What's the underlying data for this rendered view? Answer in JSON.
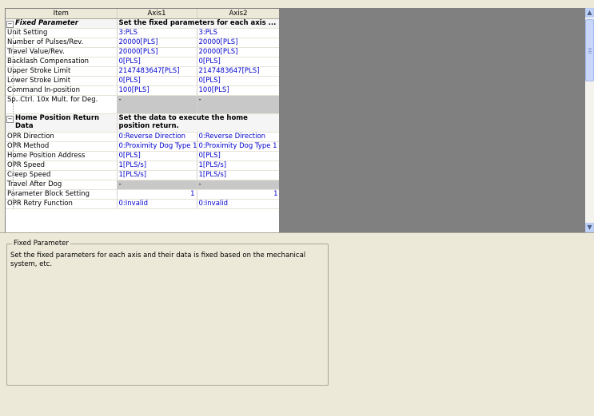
{
  "grid": {
    "headers": [
      "Item",
      "Axis1",
      "Axis2"
    ],
    "rows": [
      {
        "type": "group",
        "label": "Fixed Parameter",
        "desc": "Set the fixed parameters for each axis ..."
      },
      {
        "label": "Unit Setting",
        "a1": "3:PLS",
        "a2": "3:PLS"
      },
      {
        "label": "Number of Pulses/Rev.",
        "a1": "20000[PLS]",
        "a2": "20000[PLS]"
      },
      {
        "label": "Travel Value/Rev.",
        "a1": "20000[PLS]",
        "a2": "20000[PLS]"
      },
      {
        "label": "Backlash Compensation",
        "a1": "0[PLS]",
        "a2": "0[PLS]"
      },
      {
        "label": "Upper Stroke Limit",
        "a1": "2147483647[PLS]",
        "a2": "2147483647[PLS]"
      },
      {
        "label": "Lower Stroke Limit",
        "a1": "0[PLS]",
        "a2": "0[PLS]"
      },
      {
        "label": "Command In-position",
        "a1": "100[PLS]",
        "a2": "100[PLS]"
      },
      {
        "label": "Sp. Ctrl. 10x Mult. for Deg.",
        "a1": "-",
        "a2": "-",
        "gray": true,
        "tall": true
      },
      {
        "type": "group",
        "label": "Home Position Return Data",
        "desc": "Set the data to execute the home position return.",
        "tall": true
      },
      {
        "label": "OPR Direction",
        "a1": "0:Reverse Direction",
        "a2": "0:Reverse Direction"
      },
      {
        "label": "OPR Method",
        "a1": "0:Proximity Dog Type 1",
        "a2": "0:Proximity Dog Type 1"
      },
      {
        "label": "Home Position Address",
        "a1": "0[PLS]",
        "a2": "0[PLS]"
      },
      {
        "label": "OPR Speed",
        "a1": "1[PLS/s]",
        "a2": "1[PLS/s]"
      },
      {
        "label": "Creep Speed",
        "a1": "1[PLS/s]",
        "a2": "1[PLS/s]"
      },
      {
        "label": "Travel After Dog",
        "a1": "-",
        "a2": "-",
        "gray": true
      },
      {
        "label": "Parameter Block Setting",
        "a1": "1",
        "a2": "1",
        "num": true
      },
      {
        "label": "OPR Retry Function",
        "a1": "0:Invalid",
        "a2": "0:Invalid"
      }
    ]
  },
  "scrollbar": {
    "up": "▲",
    "down": "▼"
  },
  "description": {
    "title": "Fixed Parameter",
    "text": "Set the fixed parameters for each axis and their data is fixed based on the mechanical system, etc."
  }
}
